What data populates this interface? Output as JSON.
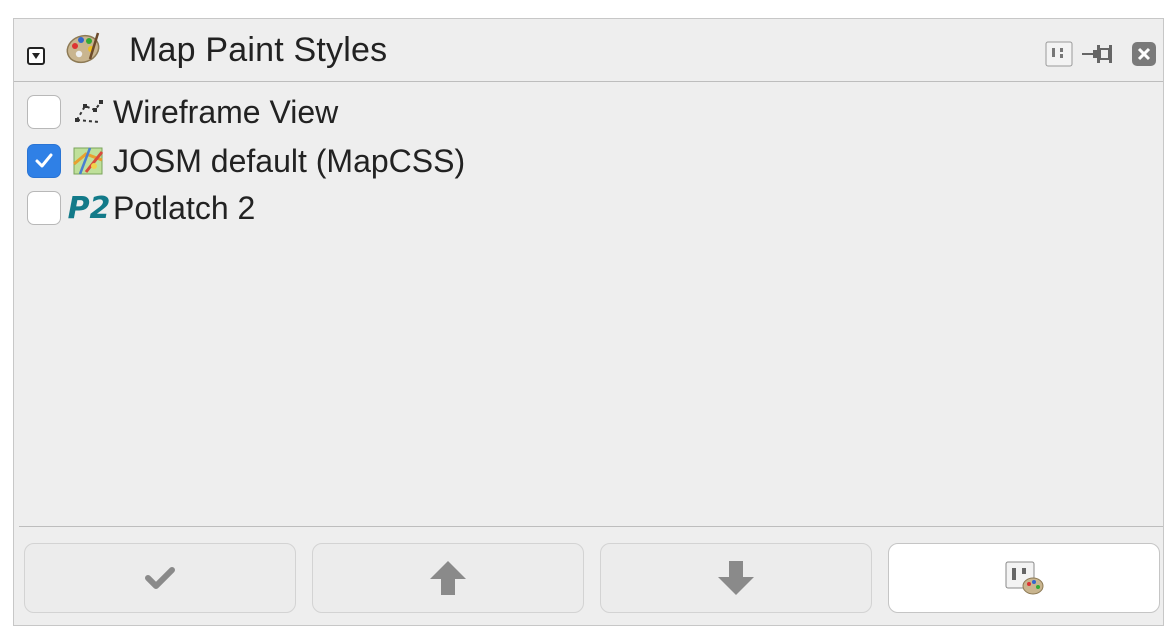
{
  "panel": {
    "title": "Map Paint Styles",
    "title_icon": "palette-icon",
    "titlebar_buttons": [
      {
        "name": "configure-panel-icon"
      },
      {
        "name": "pin-icon"
      },
      {
        "name": "close-panel-icon"
      }
    ]
  },
  "styles": [
    {
      "label": "Wireframe View",
      "checked": false,
      "icon": "wireframe-icon"
    },
    {
      "label": "JOSM default (MapCSS)",
      "checked": true,
      "icon": "josm-map-icon"
    },
    {
      "label": "Potlatch 2",
      "checked": false,
      "icon": "potlatch-icon",
      "icon_text": "P2"
    }
  ],
  "buttons": [
    {
      "name": "activate-button",
      "icon": "checkmark-icon"
    },
    {
      "name": "move-up-button",
      "icon": "arrow-up-icon"
    },
    {
      "name": "move-down-button",
      "icon": "arrow-down-icon"
    },
    {
      "name": "style-preferences-button",
      "icon": "preferences-palette-icon"
    }
  ],
  "colors": {
    "checkbox_checked": "#2f80e6",
    "potlatch_icon": "#127a89",
    "button_icon": "#8a8a8a"
  }
}
